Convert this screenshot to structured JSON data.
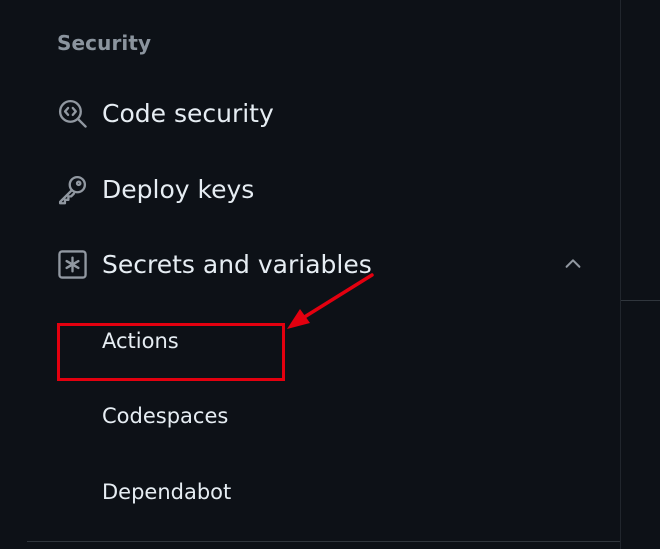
{
  "sidebar": {
    "section_heading": "Security",
    "items": [
      {
        "label": "Code security",
        "icon": "codescan-icon"
      },
      {
        "label": "Deploy keys",
        "icon": "key-icon"
      },
      {
        "label": "Secrets and variables",
        "icon": "asterisk-box-icon",
        "expanded": true
      }
    ],
    "sub_items": [
      {
        "label": "Actions",
        "highlighted": true
      },
      {
        "label": "Codespaces"
      },
      {
        "label": "Dependabot"
      }
    ]
  },
  "annotation": {
    "color": "#e3000f"
  },
  "colors": {
    "background": "#0d1117",
    "text": "#e6edf3",
    "muted": "#8b949e",
    "border": "#30363d"
  }
}
